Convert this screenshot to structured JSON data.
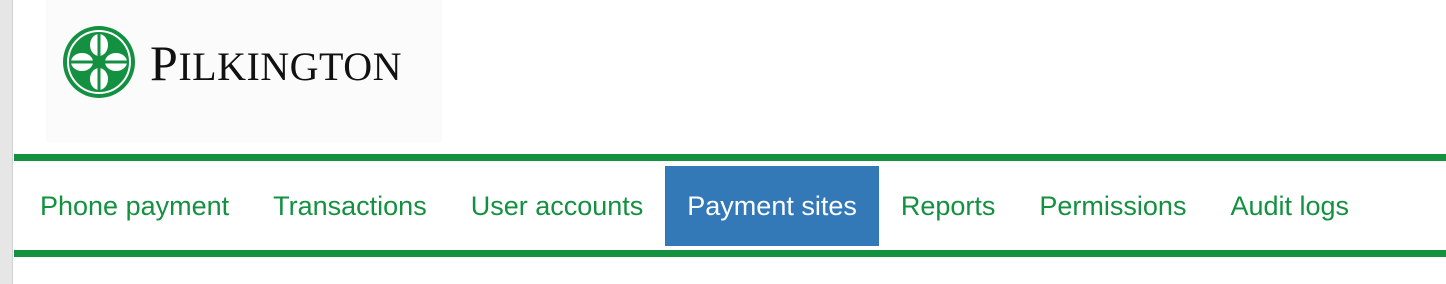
{
  "brand": {
    "name_first_letter": "P",
    "name_rest": "ILKINGTON",
    "color": "#139040"
  },
  "nav": {
    "items": [
      {
        "label": "Phone payment",
        "active": false
      },
      {
        "label": "Transactions",
        "active": false
      },
      {
        "label": "User accounts",
        "active": false
      },
      {
        "label": "Payment sites",
        "active": true
      },
      {
        "label": "Reports",
        "active": false
      },
      {
        "label": "Permissions",
        "active": false
      },
      {
        "label": "Audit logs",
        "active": false
      }
    ],
    "active_color": "#3379b8"
  }
}
